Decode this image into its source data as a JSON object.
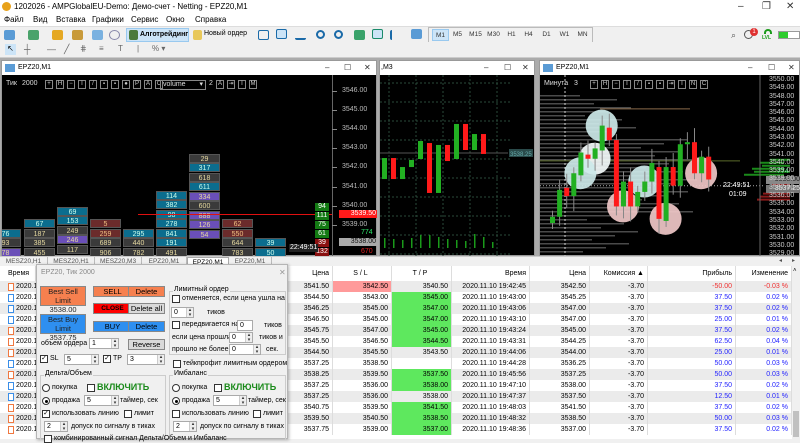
{
  "window": {
    "title": "1202026 - AMPGlobalEU-Demo: Демо-счет - Netting - EPZ20,M1",
    "minimize": "–",
    "restore": "❐",
    "close": "✕"
  },
  "menu": [
    "Файл",
    "Вид",
    "Вставка",
    "Графики",
    "Сервис",
    "Окно",
    "Справка"
  ],
  "toolbar": {
    "algo": "Алготрейдинг",
    "new_order": "Новый ордер",
    "timeframes": [
      "M1",
      "M5",
      "M15",
      "M30",
      "H1",
      "H4",
      "D1",
      "W1",
      "MN"
    ],
    "active_tf": "M1",
    "notif_count": "1",
    "lvl": "LVL"
  },
  "charts": {
    "left": {
      "title": "EPZ20,M1",
      "mode": "Тик",
      "mode_val": "2000",
      "select": "volume",
      "sel_num": "2",
      "price_ticks": [
        "3546.00",
        "3545.00",
        "3544.00",
        "3543.00",
        "3542.00",
        "3541.00",
        "3540.00",
        "3539.00"
      ],
      "bid_tag": "3539.50",
      "ask_tag": "3538.00",
      "vol_green": "774",
      "vol_red": "670",
      "time": "22:49:51",
      "side_labels": [
        {
          "v": "94",
          "c": "g"
        },
        {
          "v": "111",
          "c": "g"
        },
        {
          "v": "75",
          "c": "g"
        },
        {
          "v": "61",
          "c": "g"
        },
        {
          "v": "39",
          "c": "r"
        },
        {
          "v": "132",
          "c": "r"
        }
      ],
      "clusters": [
        [
          {
            "v": "76",
            "c": "t"
          },
          {
            "v": "93",
            "c": "d"
          },
          {
            "v": "78",
            "c": "p"
          }
        ],
        [
          {
            "v": "67",
            "c": "t"
          },
          {
            "v": "187",
            "c": "d"
          },
          {
            "v": "385",
            "c": "d"
          },
          {
            "v": "455",
            "c": "d"
          }
        ],
        [
          {
            "v": "69",
            "c": "t"
          },
          {
            "v": "153",
            "c": "t"
          },
          {
            "v": "249",
            "c": "d"
          },
          {
            "v": "246",
            "c": "p"
          },
          {
            "v": "117",
            "c": "d"
          }
        ],
        [
          {
            "v": "5",
            "c": "r"
          },
          {
            "v": "259",
            "c": "r"
          },
          {
            "v": "689",
            "c": "d"
          },
          {
            "v": "906",
            "c": "d"
          }
        ],
        [
          {
            "v": "295",
            "c": "t"
          },
          {
            "v": "440",
            "c": "d"
          },
          {
            "v": "782",
            "c": "d"
          }
        ],
        [
          {
            "v": "114",
            "c": "t"
          },
          {
            "v": "382",
            "c": "t"
          },
          {
            "v": "98",
            "c": "t"
          },
          {
            "v": "278",
            "c": "t"
          },
          {
            "v": "841",
            "c": "t"
          },
          {
            "v": "191",
            "c": "t"
          },
          {
            "v": "491",
            "c": "d"
          }
        ],
        [
          {
            "v": "29",
            "c": "d"
          },
          {
            "v": "317",
            "c": "t"
          },
          {
            "v": "618",
            "c": "d"
          },
          {
            "v": "611",
            "c": "t"
          },
          {
            "v": "334",
            "c": "p"
          },
          {
            "v": "600",
            "c": "d"
          },
          {
            "v": "888",
            "c": "p"
          },
          {
            "v": "126",
            "c": "p"
          },
          {
            "v": "54",
            "c": "p"
          }
        ],
        [
          {
            "v": "62",
            "c": "r"
          },
          {
            "v": "550",
            "c": "r"
          },
          {
            "v": "644",
            "c": "d"
          },
          {
            "v": "783",
            "c": "d"
          }
        ],
        [
          {
            "v": "39",
            "c": "t"
          },
          {
            "v": "50",
            "c": "t"
          }
        ]
      ]
    },
    "middle": {
      "title": ",M3",
      "price_tag": "3538.25",
      "candles": [
        [
          3536.08,
          3537.83
        ],
        [
          3537.83,
          3536.08
        ],
        [
          3536.08,
          3537.08
        ],
        [
          3537.08,
          3537.67
        ],
        [
          3537.75,
          3539.25
        ],
        [
          3539.08,
          3534.92
        ],
        [
          3534.92,
          3538.92
        ],
        [
          3538.92,
          3537.58
        ],
        [
          3537.75,
          3540.67
        ],
        [
          3540.67,
          3538.5
        ],
        [
          3538.5,
          3539.83
        ],
        [
          3539.83,
          3538.17
        ]
      ],
      "volumes": [
        10,
        9,
        8,
        10,
        13,
        13,
        11,
        9,
        8,
        7,
        14,
        11,
        6
      ]
    },
    "right": {
      "title": "EPZ20,M1",
      "mode": "Минута",
      "mode_val": "3",
      "price_ticks": [
        "3550.00",
        "3549.00",
        "3548.00",
        "3547.00",
        "3546.00",
        "3545.00",
        "3544.00",
        "3543.00",
        "3542.00",
        "3541.00",
        "3540.00",
        "3539.00",
        "3538.00",
        "3537.00",
        "3536.00",
        "3535.00",
        "3534.00",
        "3533.00",
        "3532.00",
        "3531.00",
        "3530.00",
        "3529.00"
      ],
      "vol_green": "774",
      "ask_tag": "3538.00",
      "bid_tag": "3537.25",
      "time": "22:49:51",
      "countdown": "01:09",
      "candles": [
        [
          3532.75,
          3533.5
        ],
        [
          3533.5,
          3536.75
        ],
        [
          3537,
          3536
        ],
        [
          3536,
          3538.75
        ],
        [
          3538.5,
          3541.25
        ],
        [
          3541,
          3540.5
        ],
        [
          3540.5,
          3541.75
        ],
        [
          3541.5,
          3544.5
        ],
        [
          3544.25,
          3542.75
        ],
        [
          3542.75,
          3534.75
        ],
        [
          3534.75,
          3537.75
        ],
        [
          3537.75,
          3534.75
        ],
        [
          3534.75,
          3536.5
        ],
        [
          3536.5,
          3537.75
        ],
        [
          3537.75,
          3540
        ],
        [
          3539.5,
          3533.25
        ],
        [
          3533,
          3539.5
        ],
        [
          3539.5,
          3537.25
        ],
        [
          3537.25,
          3542.25
        ],
        [
          3542.25,
          3542.5
        ],
        [
          3542.5,
          3538.75
        ],
        [
          3538.75,
          3540.75
        ],
        [
          3540.75,
          3538
        ]
      ],
      "bubbles": [
        {
          "candle": 7,
          "price": 3544.5,
          "type": "buy"
        },
        {
          "candle": 6,
          "price": 3540.5,
          "type": "neutral"
        },
        {
          "candle": 4,
          "price": 3538.75,
          "type": "buy"
        },
        {
          "candle": 13,
          "price": 3537.75,
          "type": "buy"
        },
        {
          "candle": 10,
          "price": 3534.75,
          "type": "sell"
        },
        {
          "candle": 16,
          "price": 3533.25,
          "type": "sell"
        },
        {
          "candle": 21,
          "price": 3538.75,
          "type": "sell"
        }
      ]
    }
  },
  "chart_tabs": [
    "MESZ20,H1",
    "MESZ20,H1",
    "MESZ20,M3",
    "EPZ20,M1",
    "EPZ20,M1",
    "EPZ20,M1"
  ],
  "active_tab": 4,
  "dialog": {
    "title": "EPZ20, Тик 2000",
    "close": "✕",
    "best_sell": "Best Sell Limit",
    "best_sell_price": "3538.00",
    "best_buy": "Best Buy Limit",
    "best_buy_price": "3537.75",
    "sell": "SELL",
    "close_btn": "CLOSE",
    "buy": "BUY",
    "delete": "Delete",
    "delete_all": "Delete all",
    "reverse": "Reverse",
    "volume_label": "объем ордера",
    "volume": "1",
    "sl_label": "SL",
    "sl": "5",
    "tp_label": "TP",
    "tp": "3",
    "limit_group": "Лимитный ордер",
    "cancel_if": "отменяется, если цена ушла на",
    "cancel_ticks": "0",
    "ticks": "тиков",
    "move_by": "передвигается на",
    "move_ticks": "0",
    "if_price": "если цена прошла",
    "if_price_val": "0",
    "ticks_and": "тиков и",
    "no_more": "прошло не более",
    "no_more_val": "0",
    "sec": "сек.",
    "tp_limit": "тейкпрофит лимитным ордером",
    "delta": {
      "title": "Дельта/Объем",
      "buy": "покупка",
      "enable": "ВКЛЮЧИТЬ",
      "sell": "продажа",
      "timer": "5",
      "timer_label": "таймер, сек",
      "use_line": "использовать линию",
      "use_line_checked": true,
      "limit": "лимит",
      "tol": "2",
      "tol_label": "допуск по сигналу в тиках"
    },
    "imb": {
      "title": "Имбаланс",
      "buy": "покупка",
      "enable": "ВКЛЮЧИТЬ",
      "sell": "продажа",
      "timer": "5",
      "timer_label": "таймер, сек",
      "use_line": "использовать линию",
      "use_line_checked": false,
      "limit": "лимит",
      "tol": "2",
      "tol_label": "допуск по сигналу в тиках"
    },
    "combined": "комбинированный сигнал Дельта/Объем и Имбаланс"
  },
  "table": {
    "headers": [
      "Время",
      "Цена",
      "S / L",
      "T / P",
      "Время",
      "Цена",
      "Комиссия ▲",
      "Прибыль",
      "Изменение"
    ],
    "rows": [
      {
        "icon": "sell",
        "t0": "2020.1",
        "price": "3541.50",
        "sl": "3542.50",
        "tp": "3540.50",
        "time": "2020.11.10 19:42:45",
        "cur": "3542.50",
        "comm": "-3.70",
        "profit": "-50.00",
        "change": "-0.03 %",
        "slc": "red",
        "tpc": ""
      },
      {
        "icon": "buy",
        "t0": "2020.1",
        "price": "3544.50",
        "sl": "3543.00",
        "tp": "3545.00",
        "time": "2020.11.10 19:43:00",
        "cur": "3545.25",
        "comm": "-3.70",
        "profit": "37.50",
        "change": "0.02 %",
        "slc": "",
        "tpc": "green"
      },
      {
        "icon": "buy",
        "t0": "2020.1",
        "price": "3546.25",
        "sl": "3545.00",
        "tp": "3547.00",
        "time": "2020.11.10 19:43:06",
        "cur": "3547.00",
        "comm": "-3.70",
        "profit": "37.50",
        "change": "0.02 %",
        "slc": "",
        "tpc": "green"
      },
      {
        "icon": "buy",
        "t0": "2020.1",
        "price": "3546.50",
        "sl": "3545.00",
        "tp": "3547.00",
        "time": "2020.11.10 19:43:10",
        "cur": "3547.00",
        "comm": "-3.70",
        "profit": "25.00",
        "change": "0.01 %",
        "slc": "",
        "tpc": "green"
      },
      {
        "icon": "sell",
        "t0": "2020.1",
        "price": "3545.75",
        "sl": "3547.00",
        "tp": "3545.00",
        "time": "2020.11.10 19:43:24",
        "cur": "3545.00",
        "comm": "-3.70",
        "profit": "37.50",
        "change": "0.02 %",
        "slc": "",
        "tpc": "green"
      },
      {
        "icon": "sell",
        "t0": "2020.1",
        "price": "3545.50",
        "sl": "3546.50",
        "tp": "3544.50",
        "time": "2020.11.10 19:43:31",
        "cur": "3544.25",
        "comm": "-3.70",
        "profit": "62.50",
        "change": "0.04 %",
        "slc": "",
        "tpc": "green"
      },
      {
        "icon": "sell",
        "t0": "2020.1",
        "price": "3544.50",
        "sl": "3545.50",
        "tp": "3543.50",
        "time": "2020.11.10 19:44:06",
        "cur": "3544.00",
        "comm": "-3.70",
        "profit": "25.00",
        "change": "0.01 %",
        "slc": "",
        "tpc": ""
      },
      {
        "icon": "buy",
        "t0": "2020.1",
        "price": "3537.25",
        "sl": "3538.50",
        "tp": "",
        "time": "2020.11.10 19:44:28",
        "cur": "3536.25",
        "comm": "-3.70",
        "profit": "50.00",
        "change": "0.03 %",
        "slc": "",
        "tpc": ""
      },
      {
        "icon": "sell",
        "t0": "2020.1",
        "price": "3538.25",
        "sl": "3539.50",
        "tp": "3537.50",
        "time": "2020.11.10 19:45:56",
        "cur": "3537.25",
        "comm": "-3.70",
        "profit": "50.00",
        "change": "0.03 %",
        "slc": "",
        "tpc": "green"
      },
      {
        "icon": "buy",
        "t0": "2020.1",
        "price": "3537.25",
        "sl": "3536.00",
        "tp": "3538.00",
        "time": "2020.11.10 19:47:10",
        "cur": "3538.00",
        "comm": "-3.70",
        "profit": "37.50",
        "change": "0.02 %",
        "slc": "",
        "tpc": "green"
      },
      {
        "icon": "buy",
        "t0": "2020.1",
        "price": "3537.25",
        "sl": "3536.00",
        "tp": "3538.00",
        "time": "2020.11.10 19:47:37",
        "cur": "3537.50",
        "comm": "-3.70",
        "profit": "12.50",
        "change": "0.01 %",
        "slc": "",
        "tpc": ""
      },
      {
        "icon": "sell",
        "t0": "2020.1",
        "price": "3540.75",
        "sl": "3539.50",
        "tp": "3541.50",
        "time": "2020.11.10 19:48:03",
        "cur": "3541.50",
        "comm": "-3.70",
        "profit": "37.50",
        "change": "0.02 %",
        "slc": "",
        "tpc": "green"
      },
      {
        "icon": "sell",
        "t0": "2020.1",
        "price": "3539.50",
        "sl": "3540.50",
        "tp": "3538.50",
        "time": "2020.11.10 19:48:32",
        "cur": "3538.50",
        "comm": "-3.70",
        "profit": "50.00",
        "change": "0.03 %",
        "slc": "",
        "tpc": "green"
      },
      {
        "icon": "sell",
        "t0": "2020.1",
        "price": "3537.75",
        "sl": "3539.00",
        "tp": "3537.00",
        "time": "2020.11.10 19:48:36",
        "cur": "3537.00",
        "comm": "-3.70",
        "profit": "37.50",
        "change": "0.02 %",
        "slc": "",
        "tpc": "green"
      }
    ]
  },
  "colors": {
    "bull": "#22b022",
    "bear": "#ff1a1a",
    "sell_btn": "#f6804f",
    "buy_btn": "#2e8ff0",
    "close_btn": "#ff0000"
  }
}
